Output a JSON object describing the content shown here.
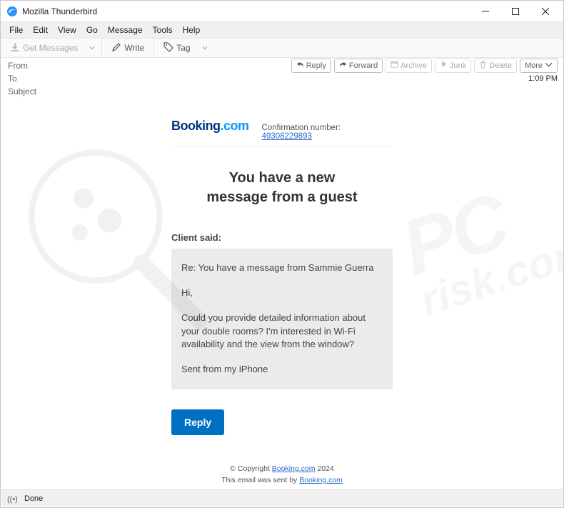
{
  "window": {
    "title": "Mozilla Thunderbird"
  },
  "menu": {
    "file": "File",
    "edit": "Edit",
    "view": "View",
    "go": "Go",
    "message": "Message",
    "tools": "Tools",
    "help": "Help"
  },
  "toolbar": {
    "get_messages": "Get Messages",
    "write": "Write",
    "tag": "Tag"
  },
  "header": {
    "from_label": "From",
    "to_label": "To",
    "subject_label": "Subject",
    "time": "1:09 PM",
    "buttons": {
      "reply": "Reply",
      "forward": "Forward",
      "archive": "Archive",
      "junk": "Junk",
      "delete": "Delete",
      "more": "More"
    }
  },
  "email": {
    "logo1": "Booking",
    "logo2": ".com",
    "confirmation_label": "Confirmation number: ",
    "confirmation_number": "49308229893",
    "headline_l1": "You have a new",
    "headline_l2": "message from a guest",
    "client_said": "Client said:",
    "msg_subject": "Re: You have a message from Sammie Guerra",
    "msg_greet": "Hi,",
    "msg_body": "Could you provide detailed information about your double rooms? I'm interested in Wi-Fi availability and the view from the window?",
    "msg_sent": "Sent from my iPhone",
    "reply_button": "Reply",
    "footer_copyright": "© Copyright ",
    "footer_brand": "Booking.com",
    "footer_year": " 2024",
    "footer_sent_by": "This email was sent by ",
    "footer_sent_link": "Booking.com"
  },
  "status": {
    "done": "Done"
  }
}
